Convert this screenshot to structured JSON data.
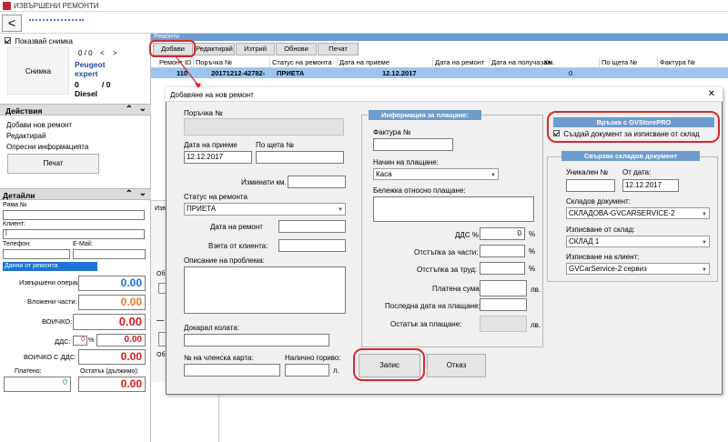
{
  "window": {
    "title": "ИЗВЪРШЕНИ РЕМОНТИ",
    "nav_title": "ГОДОР-ДАРЕ"
  },
  "left": {
    "show_image_label": "Показвай снимка",
    "photo_button": "Снимка",
    "pager": {
      "counter": "0 / 0",
      "prev": "<",
      "next": ">"
    },
    "car": {
      "make": "Peugeot",
      "model": "expert",
      "km": "0",
      "km_total": "/ 0",
      "fuel": "Diesel"
    },
    "actions": {
      "title": "Действия",
      "items": [
        "Добави нов ремонт",
        "Редактирай",
        "Опресни информацията"
      ],
      "print": "Печат"
    },
    "details": {
      "title": "Детайли",
      "frame_label": "Рама №",
      "client_label": "Клиент:",
      "client_value": "|",
      "phone_label": "Телефон:",
      "email_label": "E-Mail:",
      "tab_label": "Данни от ремонта",
      "ops_label": "Извършени операции:",
      "ops_value": "0.00",
      "parts_label": "Вложени части:",
      "parts_value": "0.00",
      "total_label": "ВОИЧКО:",
      "total_value": "0.00",
      "vat_label": "ДДС:",
      "vat_pct": "0",
      "vat_pct_sign": "%",
      "vat_value": "0.00",
      "total_vat_label": "ВОИЧКО С ДДС:",
      "total_vat_value": "0.00",
      "paid_label": "Платено:",
      "paid_value": "0",
      "rest_label": "Остатък (дължимо):",
      "rest_value": "0.00"
    }
  },
  "right": {
    "header": "Ремонти",
    "toolbar": {
      "add": "Добави",
      "edit": "Редактирай",
      "delete": "Изтрий",
      "refresh": "Обнови",
      "print": "Печат"
    },
    "grid": {
      "columns": [
        "Ремонт ID",
        "Поръчка №",
        "Статус на ремонта",
        "Дата на приеме",
        "Дата на ремонт",
        "Дата на получаван",
        "Км.",
        "По щета №",
        "Фактура №"
      ],
      "row": [
        "110",
        "20171212-42782-",
        "ПРИЕТА",
        "12.12.2017",
        "",
        "",
        "0",
        "",
        ""
      ]
    },
    "behind": {
      "label_a": "Изв",
      "label_b": "Об",
      "label_c": "Об"
    }
  },
  "dialog": {
    "title": "Добавяне на нов ремонт",
    "close": "✕",
    "order_label": "Поръчка №",
    "date_label": "Дата на приеме",
    "date_value": "12.12.2017",
    "claim_label": "По щета №",
    "km_label": "Изминати км.",
    "status_label": "Статус на ремонта",
    "status_value": "ПРИЕТА",
    "repair_date_label": "Дата на ремонт",
    "pickup_label": "Взета от клиента:",
    "problem_label": "Описание на проблема:",
    "brought_label": "Докарал колата:",
    "member_label": "№ на членска карта:",
    "fuel_label": "Налично гориво:",
    "fuel_unit": "л.",
    "payment": {
      "title": "Информация за плащане:",
      "invoice_label": "Фактура №",
      "method_label": "Начин на плащане:",
      "method_value": "Каса",
      "note_label": "Бележка относно плащане:",
      "vat_label": "ДДС %",
      "vat_value": "0",
      "disc_parts_label": "Отстъпка за части:",
      "disc_labor_label": "Отстъпка за труд:",
      "paid_label": "Платена сума:",
      "last_date_label": "Последна дата на плащане:",
      "rest_label": "Остатък за плащане:",
      "pct": "%",
      "currency": "лв."
    },
    "gvstore": {
      "title": "Връзка с GVStorePRO",
      "create_label": "Създай документ за изписване от склад"
    },
    "linked": {
      "title": "Свързан складов документ",
      "unique_label": "Уникален №",
      "from_date_label": "От дата:",
      "from_date_value": "12.12.2017",
      "doc_label": "Складов документ:",
      "doc_value": "СКЛАДОВА-GVCARSERVICE-2",
      "out_label": "Изписване от склад:",
      "out_value": "СКЛАД 1",
      "client_label": "Изписване на клиент:",
      "client_value": "GVCarService-2 сервиз"
    },
    "save": "Запис",
    "cancel": "Отказ"
  },
  "colors": {
    "accent": "#6d9ccf",
    "selected_row": "#99c5ee",
    "annotation": "#d8292e",
    "value_blue": "#1f6fd1",
    "value_orange": "#e07b28",
    "value_red": "#d81818",
    "value_green": "#2a9a2a"
  }
}
